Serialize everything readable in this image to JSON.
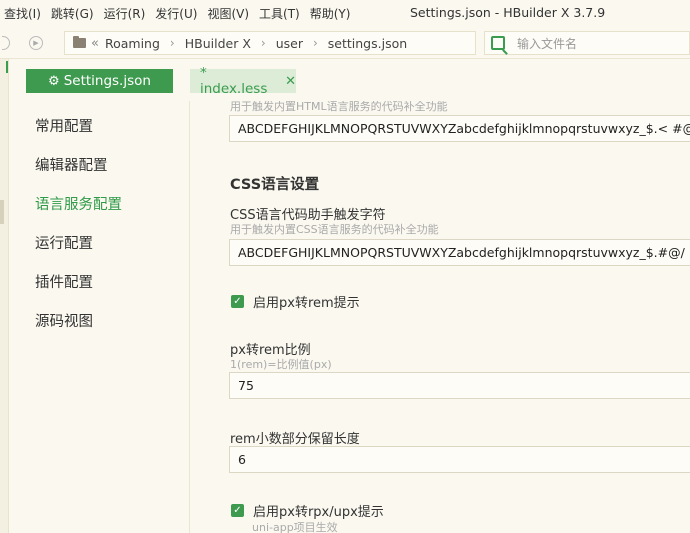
{
  "menu": [
    "查找(I)",
    "跳转(G)",
    "运行(R)",
    "发行(U)",
    "视图(V)",
    "工具(T)",
    "帮助(Y)"
  ],
  "window_title": "Settings.json - HBuilder X 3.7.9",
  "breadcrumbs": [
    "Roaming",
    "HBuilder X",
    "user",
    "settings.json"
  ],
  "search_placeholder": "输入文件名",
  "tabs": {
    "settings": "Settings.json",
    "less": "* index.less"
  },
  "sidebar": [
    "常用配置",
    "编辑器配置",
    "语言服务配置",
    "运行配置",
    "插件配置",
    "源码视图"
  ],
  "content": {
    "html_hint_partial": "用于触发内置HTML语言服务的代码补全功能",
    "html_trigger_value": "ABCDEFGHIJKLMNOPQRSTUVWXYZabcdefghijklmnopqrstuvwxyz_$.< #@",
    "css_section_title": "CSS语言设置",
    "css_trigger_label": "CSS语言代码助手触发字符",
    "css_trigger_hint": "用于触发内置CSS语言服务的代码补全功能",
    "css_trigger_value": "ABCDEFGHIJKLMNOPQRSTUVWXYZabcdefghijklmnopqrstuvwxyz_$.#@/",
    "px_rem_checkbox": "启用px转rem提示",
    "px_rem_ratio_label": "px转rem比例",
    "px_rem_ratio_hint": "1(rem)=比例值(px)",
    "px_rem_ratio_value": "75",
    "rem_decimal_label": "rem小数部分保留长度",
    "rem_decimal_value": "6",
    "px_rpx_checkbox": "启用px转rpx/upx提示",
    "px_rpx_hint": "uni-app项目生效"
  },
  "colors": {
    "accent": "#3e9a4e",
    "background": "#faf8ef"
  }
}
